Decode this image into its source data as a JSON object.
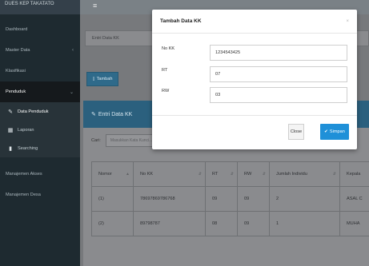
{
  "sidebar": {
    "brand": "DUES KEP TAKATATO",
    "items": [
      {
        "label": "Dashboard"
      },
      {
        "label": "Master Data",
        "chevron": "‹"
      },
      {
        "label": "Klasifikasi"
      },
      {
        "label": "Penduduk",
        "chevron": "⌄"
      }
    ],
    "sub_items": [
      {
        "label": "Data Penduduk",
        "icon": "edit-icon"
      },
      {
        "label": "Laporan",
        "icon": "table-icon"
      },
      {
        "label": "Searching",
        "icon": "file-icon"
      }
    ],
    "bottom_items": [
      {
        "label": "Manajemen Akses"
      },
      {
        "label": "Manajemen Desa"
      }
    ]
  },
  "topbar": {
    "burger_icon": "≡"
  },
  "content": {
    "breadcrumb": "Entri Data KK",
    "tambah_label": "Tambah",
    "panel_title": "Entri Data KK",
    "search_label": "Cari:",
    "search_placeholder": "Masukkan Kata Kunci...",
    "table": {
      "headers": [
        "Nomor",
        "No KK",
        "RT",
        "RW",
        "Jumlah Individu",
        "Kepala"
      ],
      "rows": [
        [
          "(1)",
          "78697869786768",
          "09",
          "09",
          "2",
          "ASAL C"
        ],
        [
          "(2)",
          "89798787",
          "08",
          "09",
          "1",
          "MUHA"
        ]
      ]
    }
  },
  "modal": {
    "title": "Tambah Data KK",
    "close_glyph": "×",
    "fields": [
      {
        "label": "No KK",
        "value": "1234543425"
      },
      {
        "label": "RT",
        "value": "07"
      },
      {
        "label": "RW",
        "value": "03"
      }
    ],
    "close_label": "Close",
    "save_label": "Simpan"
  },
  "colors": {
    "sidebar_bg": "#1e2a30",
    "header_blue": "#2b607e",
    "save_blue": "#1f90d8"
  }
}
